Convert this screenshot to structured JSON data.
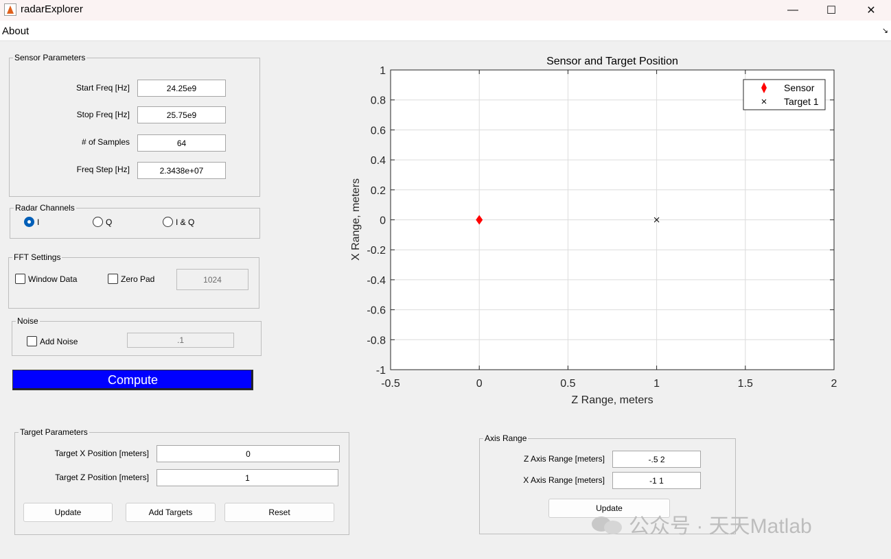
{
  "window": {
    "title": "radarExplorer",
    "minimize_glyph": "—",
    "maximize_glyph": "☐",
    "close_glyph": "✕"
  },
  "menu": {
    "about": "About"
  },
  "sensor": {
    "legend": "Sensor Parameters",
    "start_label": "Start Freq [Hz]",
    "start_value": "24.25e9",
    "stop_label": "Stop Freq [Hz]",
    "stop_value": "25.75e9",
    "samples_label": "# of Samples",
    "samples_value": "64",
    "step_label": "Freq Step [Hz]",
    "step_value": "2.3438e+07"
  },
  "channels": {
    "legend": "Radar Channels",
    "options": [
      "I",
      "Q",
      "I & Q"
    ],
    "selected": "I"
  },
  "fft": {
    "legend": "FFT Settings",
    "window_label": "Window Data",
    "zeropad_label": "Zero Pad",
    "zeropad_value": "1024"
  },
  "noise": {
    "legend": "Noise",
    "add_label": "Add Noise",
    "value": ".1"
  },
  "compute_label": "Compute",
  "target": {
    "legend": "Target Parameters",
    "x_label": "Target X Position [meters]",
    "x_value": "0",
    "z_label": "Target Z Position [meters]",
    "z_value": "1",
    "update_label": "Update",
    "add_label": "Add Targets",
    "reset_label": "Reset"
  },
  "axis_range": {
    "legend": "Axis Range",
    "z_label": "Z Axis Range [meters]",
    "z_value": "-.5 2",
    "x_label": "X Axis Range [meters]",
    "x_value": "-1 1",
    "update_label": "Update"
  },
  "watermark": "公众号 · 天天Matlab",
  "colors": {
    "compute_bg": "#0000ff",
    "sensor_marker": "#ff0000",
    "target_marker": "#000000",
    "radio_selected": "#005fb8"
  },
  "chart_data": {
    "type": "scatter",
    "title": "Sensor and Target Position",
    "xlabel": "Z Range, meters",
    "ylabel": "X Range, meters",
    "xlim": [
      -0.5,
      2
    ],
    "ylim": [
      -1,
      1
    ],
    "xticks": [
      -0.5,
      0,
      0.5,
      1,
      1.5,
      2
    ],
    "yticks": [
      1,
      0.8,
      0.6,
      0.4,
      0.2,
      0,
      -0.2,
      -0.4,
      -0.6,
      -0.8,
      -1
    ],
    "grid": true,
    "legend_position": "top-right",
    "series": [
      {
        "name": "Sensor",
        "marker": "diamond",
        "color": "#ff0000",
        "points": [
          {
            "x": 0,
            "y": 0
          }
        ]
      },
      {
        "name": "Target 1",
        "marker": "x",
        "color": "#000000",
        "points": [
          {
            "x": 1,
            "y": 0
          }
        ]
      }
    ]
  }
}
